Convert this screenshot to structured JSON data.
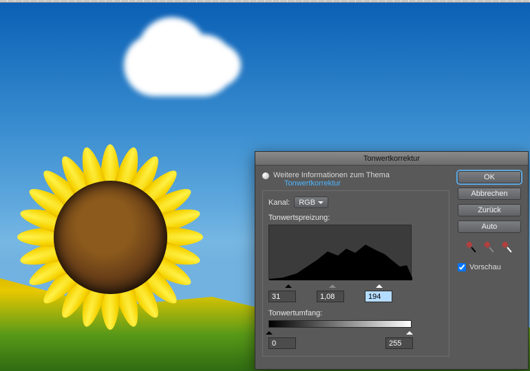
{
  "dialog": {
    "title": "Tonwertkorrektur",
    "hint_text": "Weitere Informationen zum Thema",
    "hint_link": "Tonwertkorrektur",
    "channel_label": "Kanal:",
    "channel_value": "RGB",
    "input_label": "Tonwertspreizung:",
    "output_label": "Tonwertumfang:",
    "input_values": {
      "shadow": "31",
      "gamma": "1,08",
      "highlight": "194"
    },
    "output_values": {
      "low": "0",
      "high": "255"
    },
    "buttons": {
      "ok": "OK",
      "cancel": "Abbrechen",
      "back": "Zurück",
      "auto": "Auto"
    },
    "preview_label": "Vorschau",
    "preview_checked": true
  }
}
